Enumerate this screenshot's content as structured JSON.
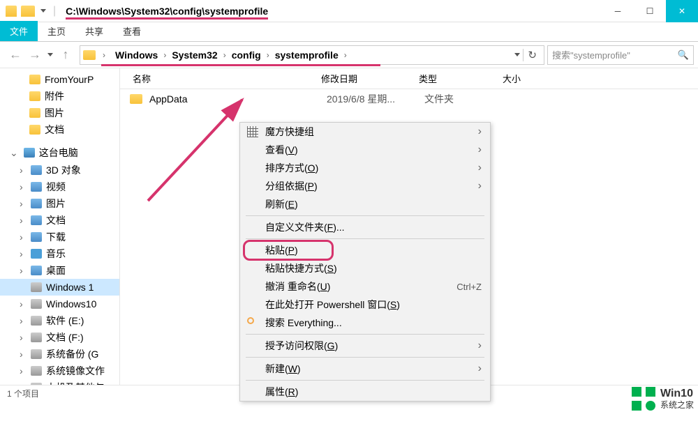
{
  "titlebar": {
    "path": "C:\\Windows\\System32\\config\\systemprofile"
  },
  "ribbon": {
    "tabs": [
      "文件",
      "主页",
      "共享",
      "查看"
    ]
  },
  "breadcrumb": {
    "segments": [
      "Windows",
      "System32",
      "config",
      "systemprofile"
    ]
  },
  "search": {
    "placeholder": "搜索\"systemprofile\""
  },
  "columns": {
    "name": "名称",
    "date": "修改日期",
    "type": "类型",
    "size": "大小"
  },
  "files": [
    {
      "name": "AppData",
      "date": "2019/6/8 星期...",
      "type": "文件夹"
    }
  ],
  "sidebar": {
    "items": [
      {
        "label": "FromYourP",
        "icon": "folder"
      },
      {
        "label": "附件",
        "icon": "folder"
      },
      {
        "label": "图片",
        "icon": "folder"
      },
      {
        "label": "文档",
        "icon": "folder"
      }
    ],
    "pc_label": "这台电脑",
    "pc_items": [
      {
        "label": "3D 对象",
        "icon": "media"
      },
      {
        "label": "视频",
        "icon": "media"
      },
      {
        "label": "图片",
        "icon": "media"
      },
      {
        "label": "文档",
        "icon": "media"
      },
      {
        "label": "下载",
        "icon": "media"
      },
      {
        "label": "音乐",
        "icon": "music"
      },
      {
        "label": "桌面",
        "icon": "media"
      },
      {
        "label": "Windows 1",
        "icon": "drive",
        "selected": true
      },
      {
        "label": "Windows10",
        "icon": "drive"
      },
      {
        "label": "软件 (E:)",
        "icon": "drive"
      },
      {
        "label": "文档 (F:)",
        "icon": "drive"
      },
      {
        "label": "系统备份 (G",
        "icon": "drive"
      },
      {
        "label": "系统镜像文作",
        "icon": "drive"
      },
      {
        "label": "本机及其他与",
        "icon": "drive"
      }
    ]
  },
  "context_menu": {
    "items": [
      {
        "label": "魔方快捷组",
        "submenu": true,
        "icon": "grid"
      },
      {
        "label": "查看(V)",
        "submenu": true,
        "u": "V"
      },
      {
        "label": "排序方式(O)",
        "submenu": true,
        "u": "O"
      },
      {
        "label": "分组依据(P)",
        "submenu": true,
        "u": "P"
      },
      {
        "label": "刷新(E)",
        "u": "E"
      },
      {
        "sep": true
      },
      {
        "label": "自定义文件夹(F)...",
        "u": "F"
      },
      {
        "sep": true
      },
      {
        "label": "粘贴(P)",
        "u": "P",
        "highlight": true
      },
      {
        "label": "粘贴快捷方式(S)",
        "u": "S"
      },
      {
        "label": "撤消 重命名(U)",
        "u": "U",
        "shortcut": "Ctrl+Z"
      },
      {
        "label": "在此处打开 Powershell 窗口(S)",
        "u": "S"
      },
      {
        "label": "搜索 Everything...",
        "icon": "search"
      },
      {
        "sep": true
      },
      {
        "label": "授予访问权限(G)",
        "submenu": true,
        "u": "G"
      },
      {
        "sep": true
      },
      {
        "label": "新建(W)",
        "submenu": true,
        "u": "W"
      },
      {
        "sep": true
      },
      {
        "label": "属性(R)",
        "u": "R"
      }
    ]
  },
  "statusbar": {
    "text": "1 个项目"
  },
  "watermark": {
    "line1": "Win10",
    "line2": "系统之家"
  }
}
